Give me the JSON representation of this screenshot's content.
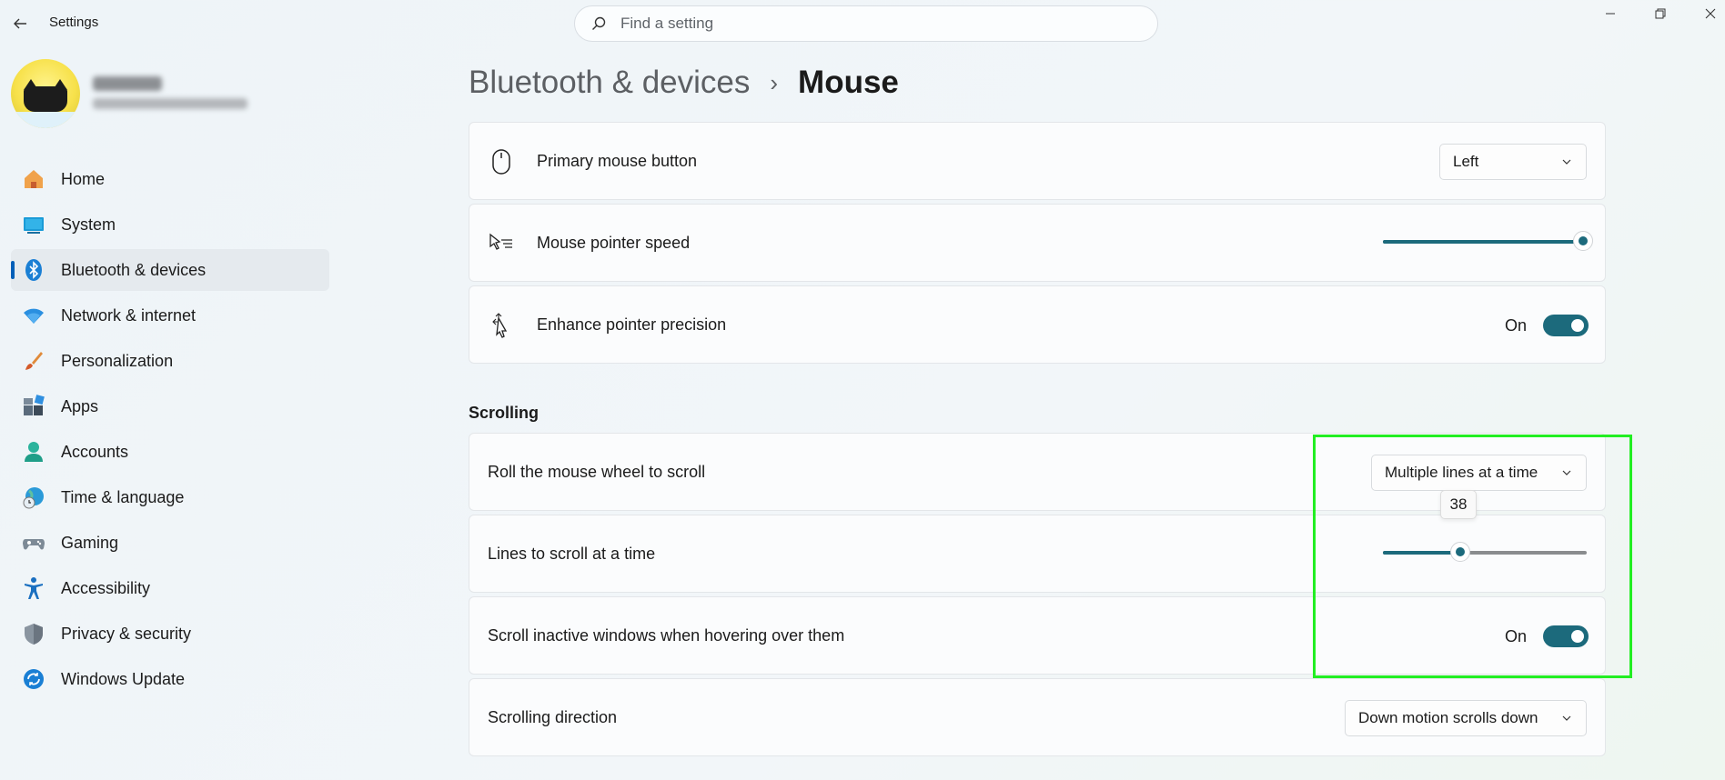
{
  "window": {
    "title": "Settings",
    "search_placeholder": "Find a setting"
  },
  "sidebar": {
    "items": [
      {
        "label": "Home",
        "icon": "home-icon"
      },
      {
        "label": "System",
        "icon": "system-icon"
      },
      {
        "label": "Bluetooth & devices",
        "icon": "bluetooth-icon",
        "active": true
      },
      {
        "label": "Network & internet",
        "icon": "wifi-icon"
      },
      {
        "label": "Personalization",
        "icon": "brush-icon"
      },
      {
        "label": "Apps",
        "icon": "apps-icon"
      },
      {
        "label": "Accounts",
        "icon": "person-icon"
      },
      {
        "label": "Time & language",
        "icon": "globe-clock-icon"
      },
      {
        "label": "Gaming",
        "icon": "gamepad-icon"
      },
      {
        "label": "Accessibility",
        "icon": "accessibility-icon"
      },
      {
        "label": "Privacy & security",
        "icon": "shield-icon"
      },
      {
        "label": "Windows Update",
        "icon": "update-icon"
      }
    ]
  },
  "breadcrumb": {
    "parent": "Bluetooth & devices",
    "separator": "›",
    "current": "Mouse"
  },
  "settings": {
    "primary_button": {
      "label": "Primary mouse button",
      "value": "Left"
    },
    "pointer_speed": {
      "label": "Mouse pointer speed",
      "value": 1.0
    },
    "enhance_precision": {
      "label": "Enhance pointer precision",
      "state": "On"
    }
  },
  "scrolling": {
    "section_title": "Scrolling",
    "roll_wheel": {
      "label": "Roll the mouse wheel to scroll",
      "value": "Multiple lines at a time"
    },
    "lines_at_time": {
      "label": "Lines to scroll at a time",
      "value": "38",
      "fraction": 0.38
    },
    "scroll_inactive": {
      "label": "Scroll inactive windows when hovering over them",
      "state": "On"
    },
    "direction": {
      "label": "Scrolling direction",
      "value": "Down motion scrolls down"
    }
  },
  "colors": {
    "accent": "#1c6a7c",
    "highlight": "#22ee22"
  }
}
